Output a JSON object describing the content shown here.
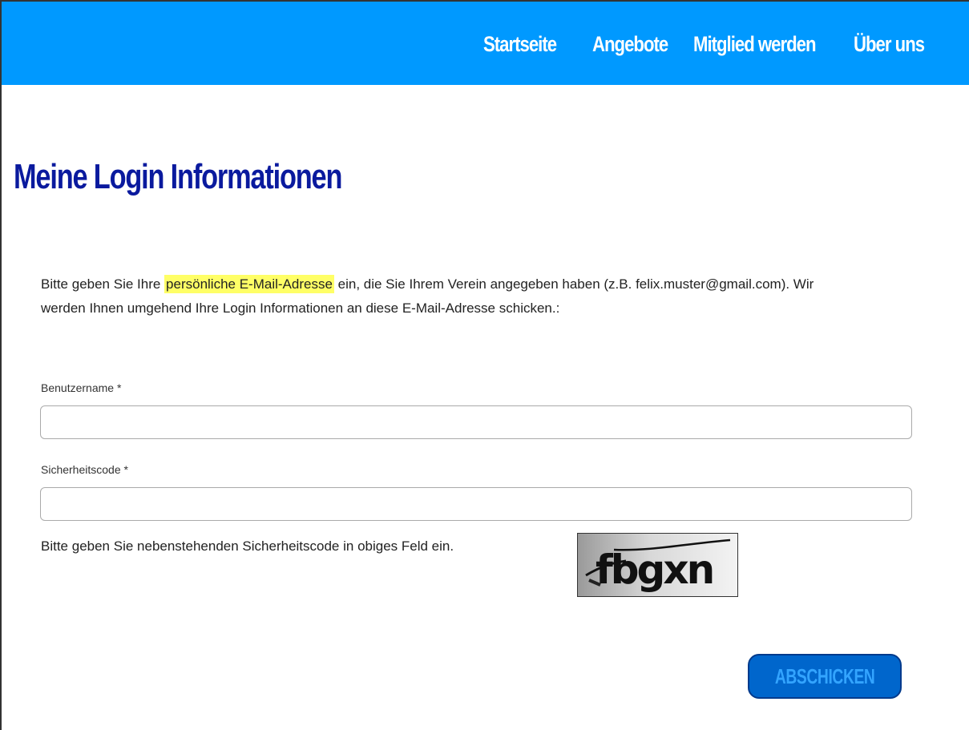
{
  "nav": {
    "items": [
      {
        "label": "Startseite"
      },
      {
        "label": "Angebote"
      },
      {
        "label": "Mitglied werden"
      },
      {
        "label": "Über uns"
      }
    ]
  },
  "page": {
    "title": "Meine Login Informationen",
    "intro_before": "Bitte geben Sie Ihre ",
    "intro_highlight": "persönliche E-Mail-Adresse",
    "intro_after": " ein, die Sie Ihrem Verein angegeben haben (z.B. felix.muster@gmail.com). Wir werden Ihnen umgehend Ihre Login Informationen an diese E-Mail-Adresse schicken.:"
  },
  "form": {
    "username_label": "Benutzername *",
    "username_value": "",
    "security_label": "Sicherheitscode *",
    "security_value": "",
    "security_hint": "Bitte geben Sie nebenstehenden Sicherheitscode in obiges Feld ein.",
    "captcha_text": "fbgxn",
    "submit_label": "ABSCHICKEN"
  },
  "colors": {
    "topbar": "#0099ff",
    "title": "#0a1a9e",
    "highlight": "#ffff66",
    "button": "#0066cc"
  }
}
